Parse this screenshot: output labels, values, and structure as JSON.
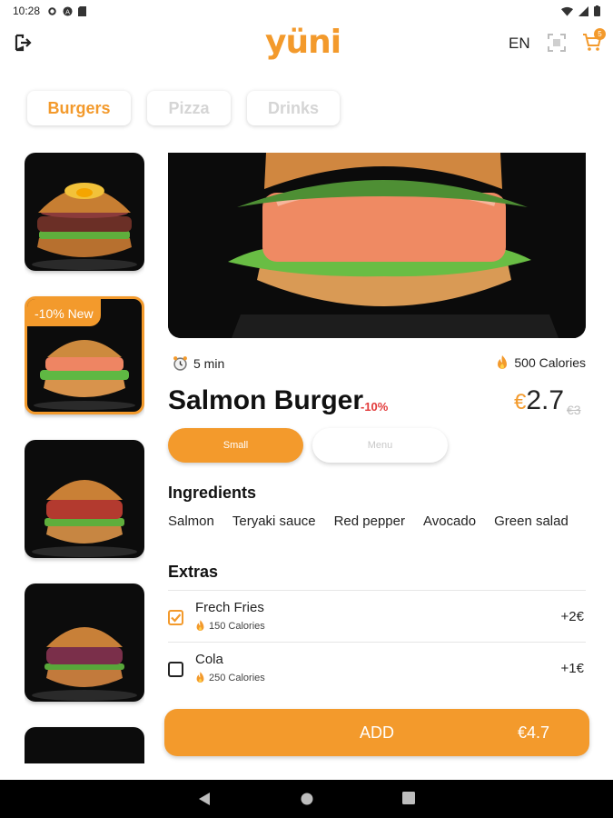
{
  "status_bar": {
    "time": "10:28"
  },
  "header": {
    "logo": "yüni",
    "language": "EN",
    "cart_count": "5"
  },
  "tabs": [
    {
      "label": "Burgers",
      "active": true
    },
    {
      "label": "Pizza",
      "active": false
    },
    {
      "label": "Drinks",
      "active": false
    }
  ],
  "thumbnails": [
    {
      "tag": ""
    },
    {
      "tag": "-10% New"
    },
    {
      "tag": ""
    },
    {
      "tag": ""
    },
    {
      "tag": ""
    }
  ],
  "product": {
    "prep_time": "5 min",
    "calories": "500 Calories",
    "name": "Salmon Burger",
    "discount": "-10%",
    "currency": "€",
    "price": "2.7",
    "old_price": "€3",
    "sizes": [
      {
        "label": "Small",
        "selected": true
      },
      {
        "label": "Menu",
        "selected": false
      }
    ]
  },
  "ingredients": {
    "title": "Ingredients",
    "items": [
      "Salmon",
      "Teryaki sauce",
      "Red pepper",
      "Avocado",
      "Green salad"
    ]
  },
  "extras": {
    "title": "Extras",
    "items": [
      {
        "name": "Frech Fries",
        "calories": "150 Calories",
        "price": "+2€",
        "checked": true
      },
      {
        "name": "Cola",
        "calories": "250 Calories",
        "price": "+1€",
        "checked": false
      }
    ]
  },
  "add_button": {
    "label": "ADD",
    "total": "€4.7"
  },
  "colors": {
    "accent": "#f39a2c",
    "discount": "#e23a3a"
  }
}
